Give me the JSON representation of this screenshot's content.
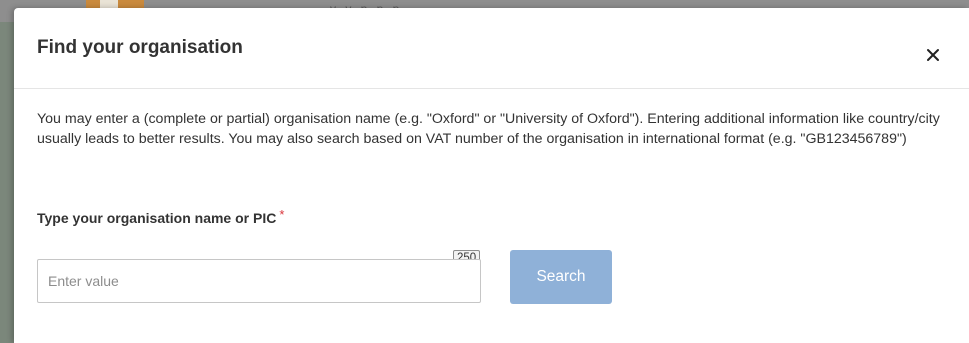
{
  "background": {
    "partial_text": "y                         y          p   p  p"
  },
  "modal": {
    "title": "Find your organisation",
    "close_symbol": "×",
    "close_icon": "close-icon",
    "help_text": "You may enter a (complete or partial) organisation name (e.g. \"Oxford\" or \"University of Oxford\"). Entering additional information like country/city usually leads to better results. You may also search based on VAT number of the organisation in international format (e.g. \"GB123456789\")",
    "field": {
      "label": "Type your organisation name or PIC",
      "required_marker": "*",
      "placeholder": "Enter value",
      "value": "",
      "char_counter": "250"
    },
    "search_button_label": "Search"
  },
  "colors": {
    "accent_button": "#8fb1d8",
    "required": "#d9343a",
    "text": "#333333",
    "overlay": "#8a8a8a"
  }
}
